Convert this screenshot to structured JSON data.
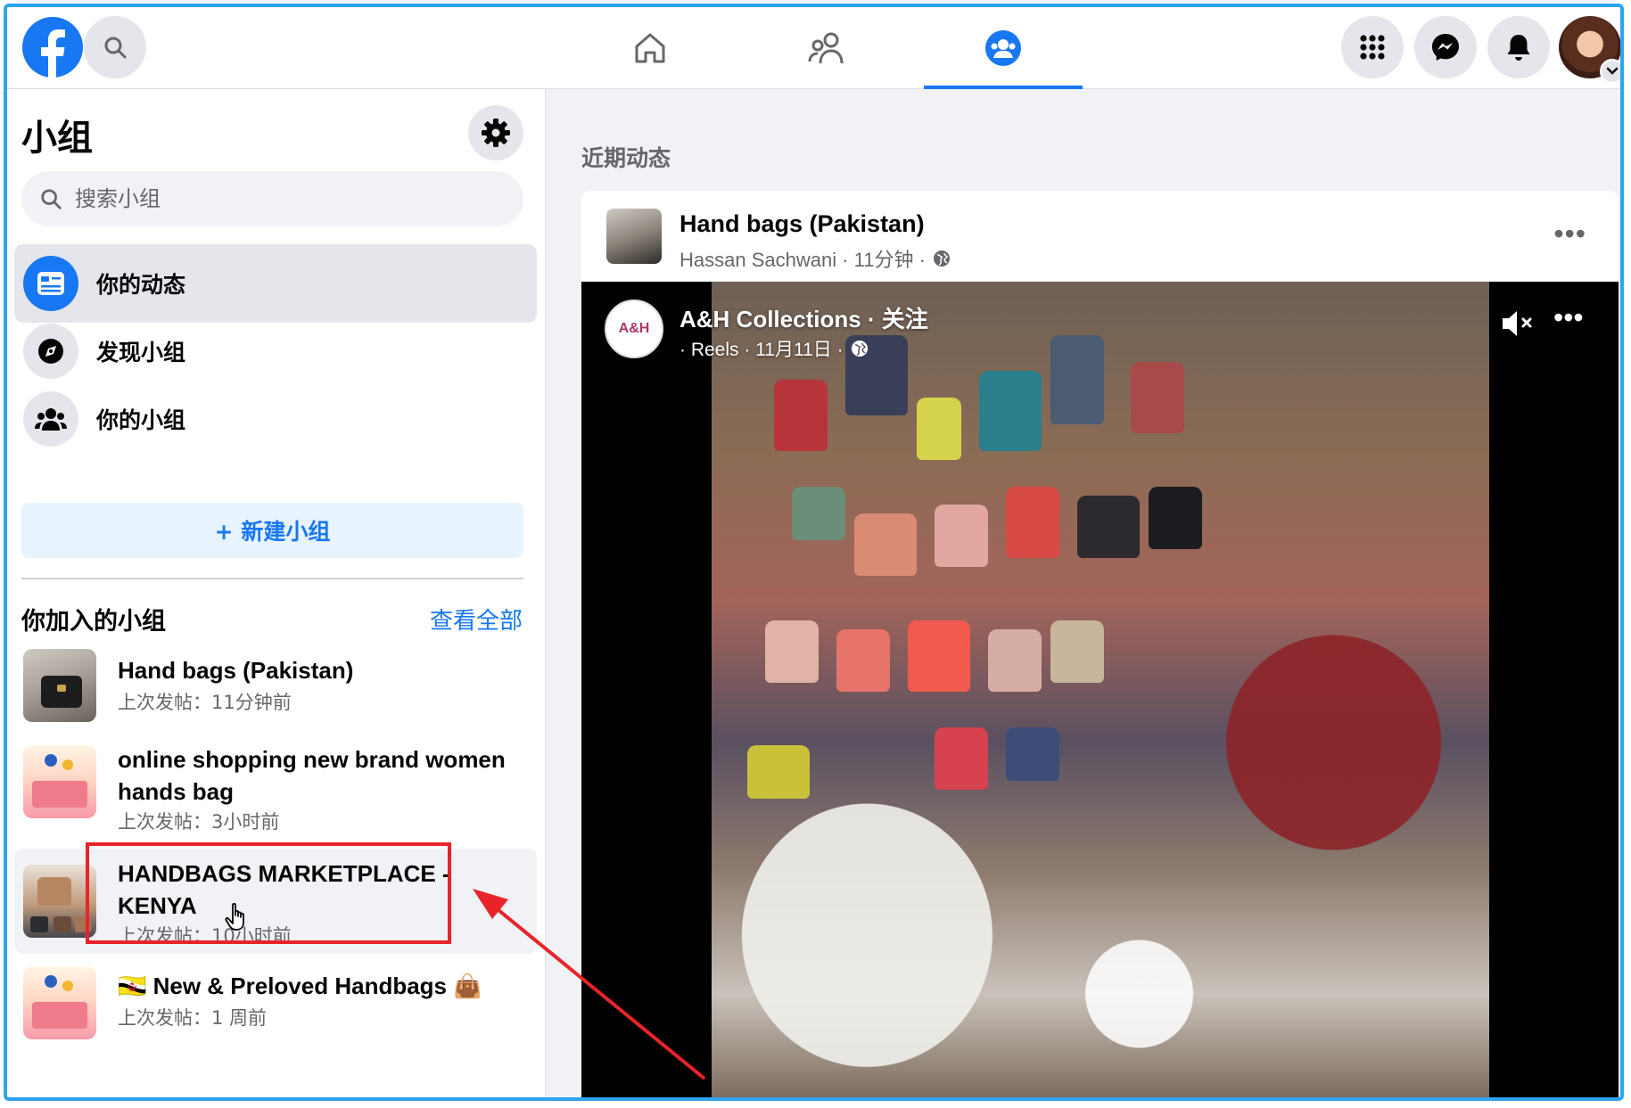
{
  "topbar": {
    "search_icon": "search-icon",
    "nav_tabs": [
      {
        "name": "home",
        "icon": "home-icon"
      },
      {
        "name": "friends",
        "icon": "friends-icon"
      },
      {
        "name": "groups",
        "icon": "groups-icon",
        "active": true
      }
    ],
    "right_icons": [
      "menu-grid-icon",
      "messenger-icon",
      "bell-icon"
    ],
    "accent_color": "#1877f2"
  },
  "sidebar": {
    "title": "小组",
    "search_placeholder": "搜索小组",
    "menu": [
      {
        "label": "你的动态",
        "icon": "feed-icon",
        "active": true
      },
      {
        "label": "发现小组",
        "icon": "compass-icon"
      },
      {
        "label": "你的小组",
        "icon": "people-icon"
      }
    ],
    "new_group_label": "+ 新建小组",
    "joined_title": "你加入的小组",
    "see_all": "查看全部",
    "groups": [
      {
        "name": "Hand bags (Pakistan)",
        "meta": "上次发帖：11分钟前"
      },
      {
        "name": "online shopping new brand women hands bag",
        "meta": "上次发帖：3小时前"
      },
      {
        "name": "HANDBAGS MARKETPLACE - KENYA",
        "meta": "上次发帖：10小时前"
      },
      {
        "name": "🇧🇳 New & Preloved Handbags 👜",
        "meta": "上次发帖：1 周前"
      }
    ]
  },
  "feed": {
    "label": "近期动态",
    "post": {
      "group": "Hand bags (Pakistan)",
      "meta": "Hassan Sachwani · 11分钟 ·",
      "video": {
        "avatar_text": "A&H",
        "title": "A&H Collections · 关注",
        "meta": "· Reels · 11月11日 ·"
      }
    }
  },
  "annotation": {
    "color": "#e8242a"
  }
}
